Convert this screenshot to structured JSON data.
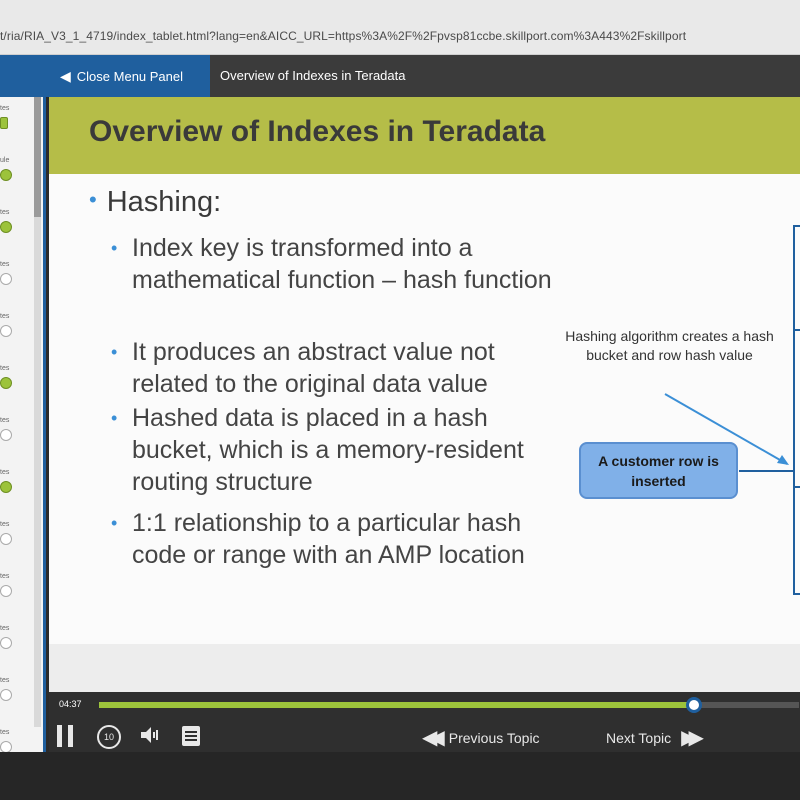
{
  "browser": {
    "url": "t/ria/RIA_V3_1_4719/index_tablet.html?lang=en&AICC_URL=https%3A%2F%2Fpvsp81ccbe.skillport.com%3A443%2Fskillport"
  },
  "header": {
    "close_menu_label": "Close Menu Panel",
    "topic_title": "Overview of Indexes in Teradata"
  },
  "rail": {
    "items": [
      {
        "label": "tes",
        "status": "partial"
      },
      {
        "label": "ule",
        "status": "done"
      },
      {
        "label": "tes",
        "status": "done"
      },
      {
        "label": "tes",
        "status": "empty"
      },
      {
        "label": "tes",
        "status": "empty"
      },
      {
        "label": "tes",
        "status": "done"
      },
      {
        "label": "tes",
        "status": "empty"
      },
      {
        "label": "tes",
        "status": "done"
      },
      {
        "label": "tes",
        "status": "empty"
      },
      {
        "label": "tes",
        "status": "empty"
      },
      {
        "label": "tes",
        "status": "empty"
      },
      {
        "label": "tes",
        "status": "empty"
      },
      {
        "label": "tes",
        "status": "empty"
      }
    ]
  },
  "slide": {
    "title": "Overview of Indexes in Teradata",
    "main_bullet": "Hashing:",
    "sub_bullets": [
      "Index key is transformed into a mathematical function – hash function",
      "It produces an abstract value not related to the original data value",
      "Hashed data is placed in a hash bucket, which is a memory-resident routing structure",
      "1:1 relationship to a particular hash code or range with an AMP location"
    ],
    "callout": "Hashing algorithm creates a hash bucket and row hash value",
    "customer_box": "A customer row is inserted"
  },
  "player": {
    "elapsed": "04:37",
    "progress": 0.85,
    "replay_label": "10",
    "prev_label": "Previous Topic",
    "next_label": "Next Topic"
  },
  "colors": {
    "title_bar": "#b5bd48",
    "accent_blue": "#1f5f9e",
    "bullet_blue": "#3b8fd6",
    "progress_green": "#9cc33b"
  }
}
